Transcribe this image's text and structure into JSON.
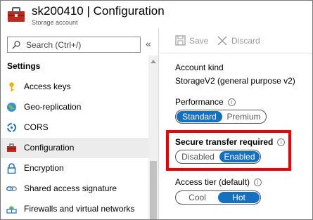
{
  "header": {
    "title": "sk200410 | Configuration",
    "subtitle": "Storage account",
    "icon": "storage-account-icon"
  },
  "sidebar": {
    "search": {
      "placeholder": "Search (Ctrl+/)",
      "value": "",
      "icon": "search-icon"
    },
    "collapse_label": "«",
    "section_heading": "Settings",
    "items": [
      {
        "label": "Access keys",
        "icon": "key-icon"
      },
      {
        "label": "Geo-replication",
        "icon": "globe-icon"
      },
      {
        "label": "CORS",
        "icon": "cors-icon"
      },
      {
        "label": "Configuration",
        "icon": "toolbox-icon",
        "active": true
      },
      {
        "label": "Encryption",
        "icon": "lock-icon"
      },
      {
        "label": "Shared access signature",
        "icon": "link-icon"
      },
      {
        "label": "Firewalls and virtual networks",
        "icon": "firewall-icon"
      }
    ]
  },
  "toolbar": {
    "save_label": "Save",
    "discard_label": "Discard"
  },
  "config": {
    "account_kind": {
      "label": "Account kind",
      "value": "StorageV2 (general purpose v2)"
    },
    "performance": {
      "label": "Performance",
      "options": [
        "Standard",
        "Premium"
      ],
      "selected": "Standard"
    },
    "secure_transfer": {
      "label": "Secure transfer required",
      "options": [
        "Disabled",
        "Enabled"
      ],
      "selected": "Enabled"
    },
    "access_tier": {
      "label": "Access tier (default)",
      "options": [
        "Cool",
        "Hot"
      ],
      "selected": "Hot"
    },
    "info_glyph": "i"
  },
  "colors": {
    "accent": "#1570c0",
    "highlight": "#ee0000",
    "active_nav_bg": "#ececec"
  }
}
